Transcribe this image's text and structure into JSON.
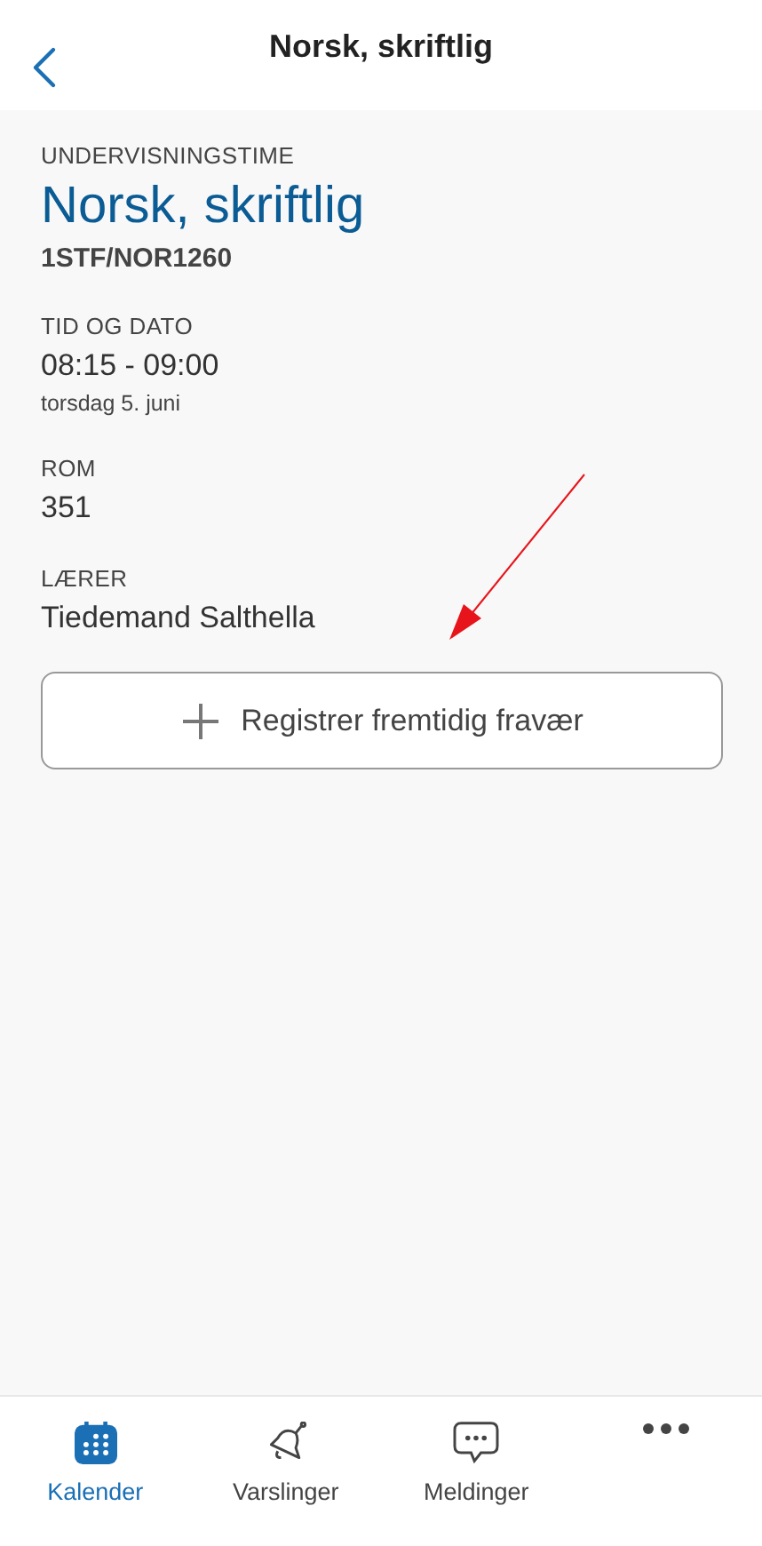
{
  "header": {
    "title": "Norsk, skriftlig"
  },
  "lesson": {
    "type_label": "UNDERVISNINGSTIME",
    "title": "Norsk, skriftlig",
    "code": "1STF/NOR1260"
  },
  "fields": [
    {
      "label": "TID OG DATO",
      "value": "08:15 - 09:00",
      "detail": "torsdag 5. juni"
    },
    {
      "label": "ROM",
      "value": "351"
    },
    {
      "label": "LÆRER",
      "value": "Tiedemand Salthella"
    }
  ],
  "action_button": {
    "label": "Registrer fremtidig fravær"
  },
  "annotation": {
    "kind": "arrow"
  },
  "tabs": [
    {
      "kind": "calendar",
      "label": "Kalender",
      "selected": true
    },
    {
      "kind": "bell",
      "label": "Varslinger",
      "selected": false
    },
    {
      "kind": "chat",
      "label": "Meldinger",
      "selected": false
    },
    {
      "kind": "more",
      "selected": false
    }
  ]
}
